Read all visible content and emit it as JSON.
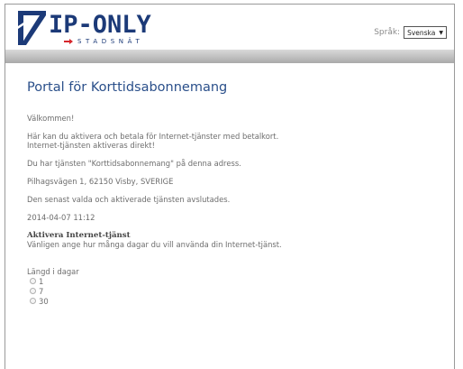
{
  "header": {
    "logo_text": "IP-ONLY",
    "logo_subtext": "STADSNÄT",
    "language_label": "Språk:",
    "language_selected": "Svenska"
  },
  "page": {
    "title": "Portal för Korttidsabonnemang",
    "welcome": "Välkommen!",
    "info_line1": "Här kan du aktivera och betala för Internet-tjänster med betalkort.",
    "info_line2": "Internet-tjänsten aktiveras direkt!",
    "service_text": "Du har tjänsten \"Korttidsabonnemang\" på denna adress.",
    "address": "Pilhagsvägen 1, 62150 Visby, SVERIGE",
    "last_activated_text": "Den senast valda och aktiverade tjänsten avslutades.",
    "last_activated_datetime": "2014-04-07 11:12",
    "activate_heading": "Aktivera Internet-tjänst",
    "activate_instruction": "Vänligen ange hur många dagar du vill använda din Internet-tjänst.",
    "days_label": "Längd i dagar",
    "day_options": [
      "1",
      "7",
      "30"
    ]
  },
  "colors": {
    "title": "#2a4f8a",
    "logo": "#1c3a78",
    "logo_accent": "#d6262b",
    "body_text": "#6e6e6e"
  }
}
